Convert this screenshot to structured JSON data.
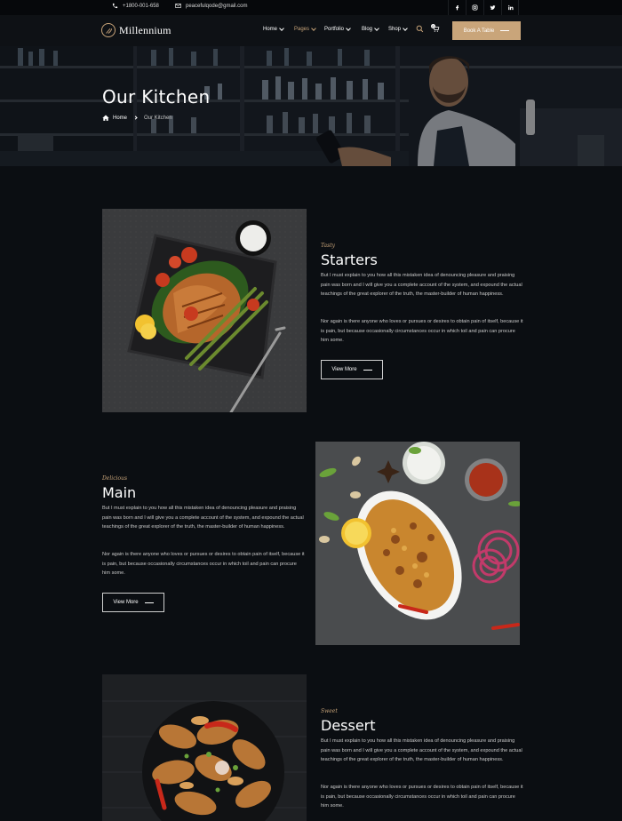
{
  "topbar": {
    "phone": "+1800-001-658",
    "email": "peacefulqode@gmail.com",
    "socials": [
      "facebook-icon",
      "instagram-icon",
      "twitter-icon",
      "linkedin-icon"
    ]
  },
  "nav": {
    "brand": "Millennium",
    "items": [
      {
        "label": "Home",
        "active": false
      },
      {
        "label": "Pages",
        "active": true
      },
      {
        "label": "Portfolio",
        "active": false
      },
      {
        "label": "Blog",
        "active": false
      },
      {
        "label": "Shop",
        "active": false
      }
    ],
    "cart_count": "0",
    "cta": "Book A Table"
  },
  "hero": {
    "title": "Our Kitchen",
    "breadcrumb_home": "Home",
    "breadcrumb_current": "Our Kitchen"
  },
  "sections": [
    {
      "tagline": "Tasty",
      "title": "Starters",
      "para1": "But I must explain to you how all this mistaken idea of denouncing pleasure and praising pain was born and I will give you a complete account of the system, and expound the actual teachings of the great explorer of the truth, the master-builder of human happiness.",
      "para2": "Nor again is there anyone who loves or pursues or desires to obtain pain of itself, because it is pain, but because occasionally circumstances occur in which toil and pain can procure him some.",
      "button": "View More"
    },
    {
      "tagline": "Delicious",
      "title": "Main",
      "para1": "But I must explain to you how all this mistaken idea of denouncing pleasure and praising pain was born and I will give you a complete account of the system, and expound the actual teachings of the great explorer of the truth, the master-builder of human happiness.",
      "para2": "Nor again is there anyone who loves or pursues or desires to obtain pain of itself, because it is pain, but because occasionally circumstances occur in which toil and pain can procure him some.",
      "button": "View More"
    },
    {
      "tagline": "Sweet",
      "title": "Dessert",
      "para1": "But I must explain to you how all this mistaken idea of denouncing pleasure and praising pain was born and I will give you a complete account of the system, and expound the actual teachings of the great explorer of the truth, the master-builder of human happiness.",
      "para2": "Nor again is there anyone who loves or pursues or desires to obtain pain of itself, because it is pain, but because occasionally circumstances occur in which toil and pain can procure him some."
    }
  ],
  "colors": {
    "accent": "#c9a57a",
    "background": "#0b0e12",
    "topbar": "#06080b"
  }
}
